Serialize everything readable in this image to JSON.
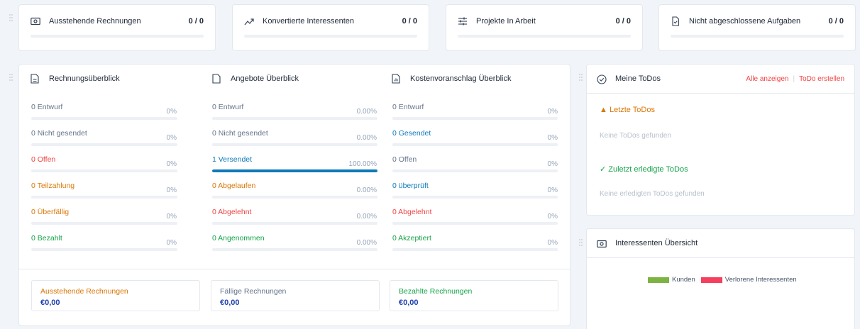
{
  "stats": [
    {
      "label": "Ausstehende Rechnungen",
      "count": "0 / 0",
      "icon": "money-icon"
    },
    {
      "label": "Konvertierte Interessenten",
      "count": "0 / 0",
      "icon": "trend-up-icon"
    },
    {
      "label": "Projekte In Arbeit",
      "count": "0 / 0",
      "icon": "sliders-icon"
    },
    {
      "label": "Nicht abgeschlossene Aufgaben",
      "count": "0 / 0",
      "icon": "task-file-icon"
    }
  ],
  "overview": {
    "invoices": {
      "title": "Rechnungsüberblick",
      "rows": [
        {
          "label": "0 Entwurf",
          "pct": "0%",
          "progress": 0
        },
        {
          "label": "0 Nicht gesendet",
          "pct": "0%",
          "progress": 0
        },
        {
          "label": "0 Offen",
          "pct": "0%",
          "progress": 0
        },
        {
          "label": "0 Teilzahlung",
          "pct": "0%",
          "progress": 0
        },
        {
          "label": "0 Überfällig",
          "pct": "0%",
          "progress": 0
        },
        {
          "label": "0 Bezahlt",
          "pct": "0%",
          "progress": 0
        }
      ]
    },
    "quotes": {
      "title": "Angebote Überblick",
      "rows": [
        {
          "label": "0 Entwurf",
          "pct": "0.00%",
          "progress": 0
        },
        {
          "label": "0 Nicht gesendet",
          "pct": "0.00%",
          "progress": 0
        },
        {
          "label": "1 Versendet",
          "pct": "100.00%",
          "progress": 1
        },
        {
          "label": "0 Abgelaufen",
          "pct": "0.00%",
          "progress": 0
        },
        {
          "label": "0 Abgelehnt",
          "pct": "0.00%",
          "progress": 0
        },
        {
          "label": "0 Angenommen",
          "pct": "0.00%",
          "progress": 0
        }
      ]
    },
    "estimates": {
      "title": "Kostenvoranschlag Überblick",
      "rows": [
        {
          "label": "0 Entwurf",
          "pct": "0%",
          "progress": 0
        },
        {
          "label": "0 Gesendet",
          "pct": "0%",
          "progress": 0
        },
        {
          "label": "0 Offen",
          "pct": "0%",
          "progress": 0
        },
        {
          "label": "0 überprüft",
          "pct": "0%",
          "progress": 0
        },
        {
          "label": "0 Abgelehnt",
          "pct": "0%",
          "progress": 0
        },
        {
          "label": "0 Akzeptiert",
          "pct": "0%",
          "progress": 0
        }
      ]
    },
    "summary": [
      {
        "title": "Ausstehende Rechnungen",
        "value": "€0,00"
      },
      {
        "title": "Fällige Rechnungen",
        "value": "€0,00"
      },
      {
        "title": "Bezahlte Rechnungen",
        "value": "€0,00"
      }
    ]
  },
  "todos": {
    "title": "Meine ToDos",
    "view_all": "Alle anzeigen",
    "create": "ToDo erstellen",
    "latest_heading": "Letzte ToDos",
    "latest_empty": "Keine ToDos gefunden",
    "done_heading": "Zuletzt erledigte ToDos",
    "done_empty": "Keine erledigten ToDos gefunden"
  },
  "leads": {
    "title": "Interessenten Übersicht",
    "legend": [
      {
        "name": "Kunden",
        "color": "#7cb342"
      },
      {
        "name": "Verlorene Interessenten",
        "color": "#f43f5e"
      }
    ]
  },
  "colors": {
    "progress": "#0e7ab8"
  }
}
